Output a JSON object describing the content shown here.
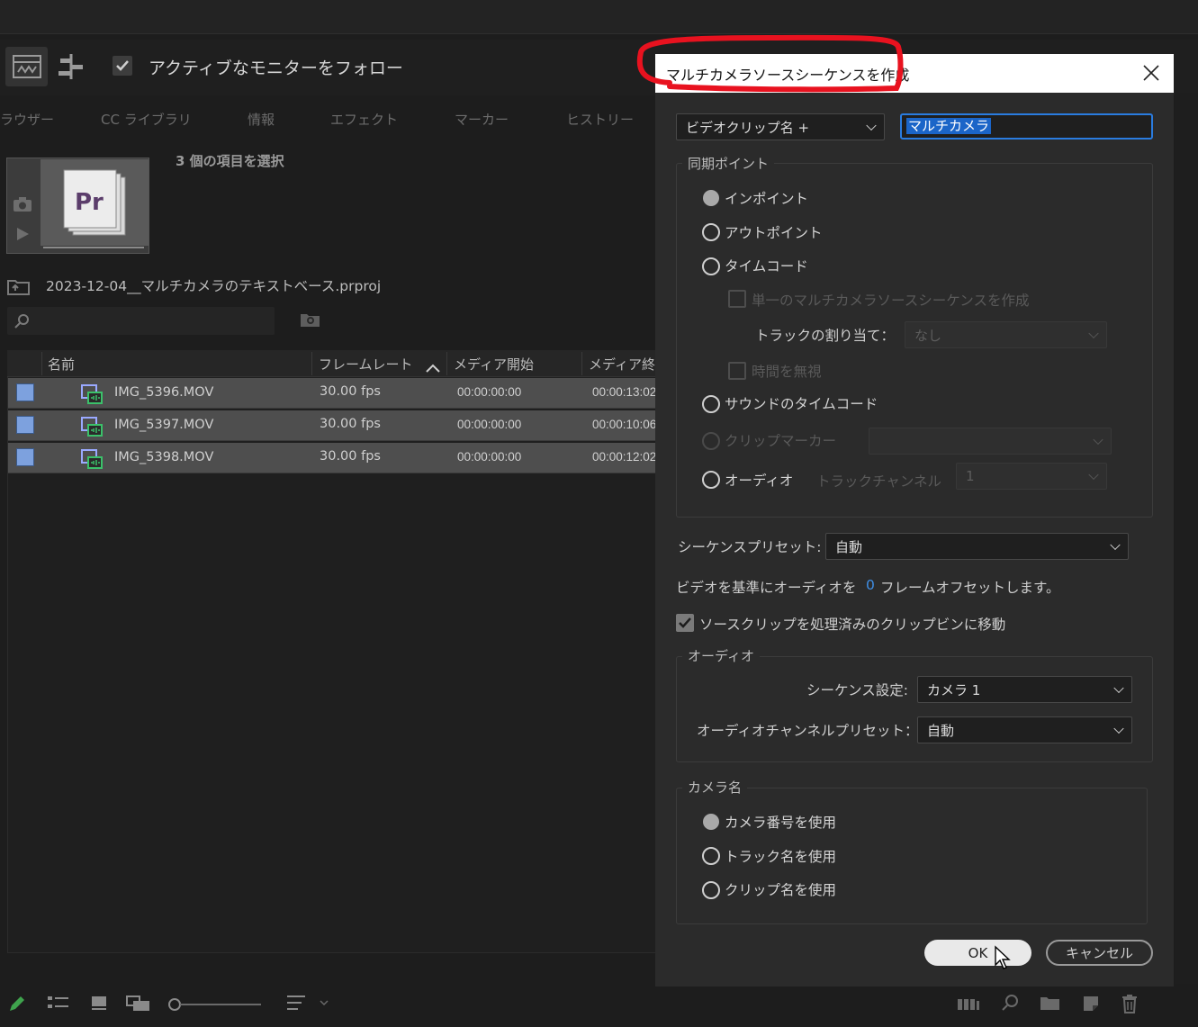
{
  "toolbar": {
    "follow_label": "アクティブなモニターをフォロー"
  },
  "tabs": [
    "ラウザー",
    "CC ライブラリ",
    "情報",
    "エフェクト",
    "マーカー",
    "ヒストリー"
  ],
  "project": {
    "selection_count": "3 個の項目を選択",
    "project_name": "2023-12-04__マルチカメラのテキストベース.prproj",
    "columns": {
      "name": "名前",
      "frame_rate": "フレームレート",
      "media_start": "メディア開始",
      "media_end": "メディア終"
    },
    "rows": [
      {
        "name": "IMG_5396.MOV",
        "fps": "30.00 fps",
        "start": "00:00:00:00",
        "end": "00:00:13:02"
      },
      {
        "name": "IMG_5397.MOV",
        "fps": "30.00 fps",
        "start": "00:00:00:00",
        "end": "00:00:10:06"
      },
      {
        "name": "IMG_5398.MOV",
        "fps": "30.00 fps",
        "start": "00:00:00:00",
        "end": "00:00:12:02"
      }
    ]
  },
  "dialog": {
    "title": "マルチカメラソースシーケンスを作成",
    "name_mode": "ビデオクリップ名 +",
    "name_value": "マルチカメラ",
    "sync_group": "同期ポイント",
    "sync": {
      "in_point": "インポイント",
      "out_point": "アウトポイント",
      "timecode": "タイムコード",
      "single_seq": "単一のマルチカメラソースシーケンスを作成",
      "track_assign_label": "トラックの割り当て：",
      "track_assign_value": "なし",
      "ignore_time": "時間を無視",
      "sound_timecode": "サウンドのタイムコード",
      "clip_marker": "クリップマーカー",
      "audio": "オーディオ",
      "track_channel_label": "トラックチャンネル",
      "track_channel_value": "1"
    },
    "sequence_preset_label": "シーケンスプリセット:",
    "sequence_preset_value": "自動",
    "offset_prefix": "ビデオを基準にオーディオを",
    "offset_value": "0",
    "offset_suffix": "フレームオフセットします。",
    "move_clips": "ソースクリップを処理済みのクリップビンに移動",
    "audio_group": "オーディオ",
    "audio_seq_label": "シーケンス設定:",
    "audio_seq_value": "カメラ 1",
    "audio_channel_label": "オーディオチャンネルプリセット：",
    "audio_channel_value": "自動",
    "camera_group": "カメラ名",
    "camera": {
      "use_number": "カメラ番号を使用",
      "use_track": "トラック名を使用",
      "use_clip": "クリップ名を使用"
    },
    "ok": "OK",
    "cancel": "キャンセル"
  }
}
